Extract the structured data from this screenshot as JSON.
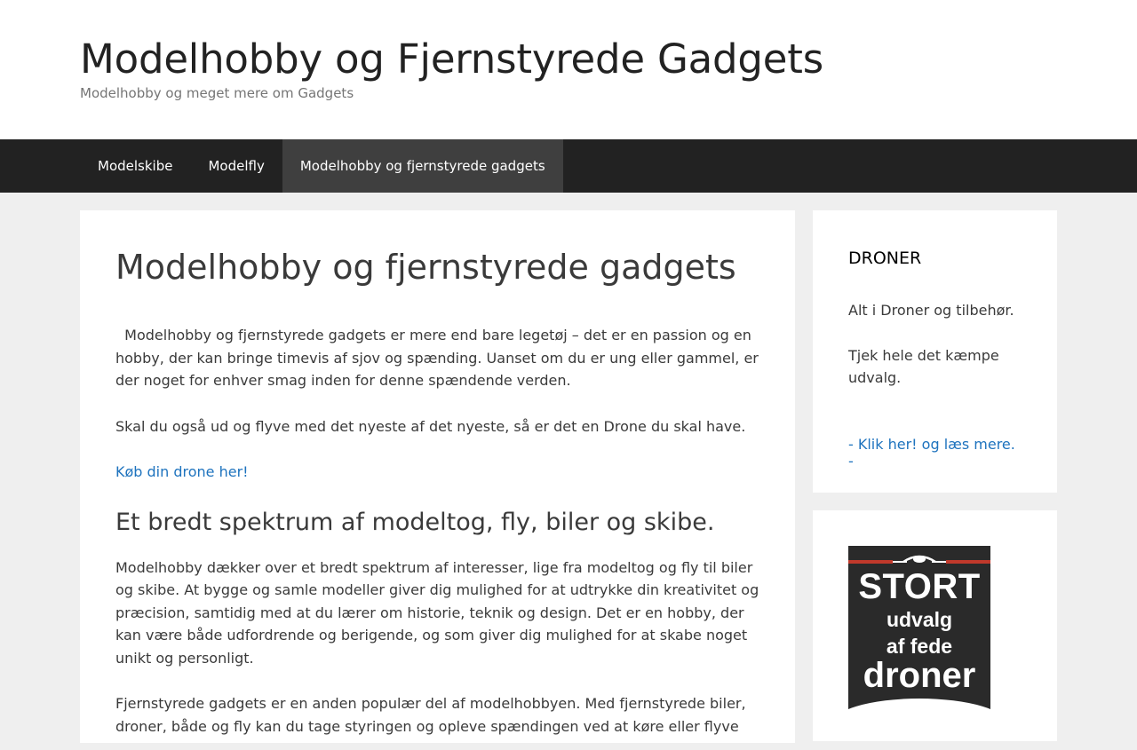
{
  "header": {
    "site_title": "Modelhobby og Fjernstyrede Gadgets",
    "tagline": "Modelhobby og meget mere om Gadgets"
  },
  "nav": {
    "items": [
      {
        "label": "Modelskibe"
      },
      {
        "label": "Modelfly"
      },
      {
        "label": "Modelhobby og fjernstyrede gadgets",
        "current": true
      }
    ]
  },
  "article": {
    "title": "Modelhobby og fjernstyrede gadgets",
    "p1": "  Modelhobby og fjernstyrede gadgets er mere end bare legetøj – det er en passion og en hobby, der kan bringe timevis af sjov og spænding. Uanset om du er ung eller gammel, er der noget for enhver smag inden for denne spændende verden.",
    "p2": "Skal du også ud og flyve med det nyeste af det nyeste, så er det en Drone du skal have.",
    "link": "Køb din drone her!",
    "h2": "Et bredt spektrum af modeltog, fly, biler og skibe.",
    "p3": "Modelhobby dækker over et bredt spektrum af interesser, lige fra modeltog og fly til biler og skibe. At bygge og samle modeller giver dig mulighed for at udtrykke din kreativitet og præcision, samtidig med at du lærer om historie, teknik og design. Det er en hobby, der kan være både udfordrende og berigende, og som giver dig mulighed for at skabe noget unikt og personligt.",
    "p4": "Fjernstyrede gadgets er en anden populær del af modelhobbyen. Med fjernstyrede biler, droner, både og fly kan du tage styringen og opleve spændingen ved at køre eller flyve dit eget køretøj."
  },
  "sidebar": {
    "widget1": {
      "title": "DRONER",
      "p1": "Alt i Droner og tilbehør.",
      "p2": "Tjek hele det kæmpe udvalg.",
      "link": "- Klik her! og læs mere. -"
    },
    "banner": {
      "line1": "STORT",
      "line2": "udvalg",
      "line3": "af fede",
      "line4": "droner"
    }
  },
  "colors": {
    "accent_link": "#1e73be",
    "nav_bg": "#222222",
    "nav_current_bg": "#3f3f3f",
    "page_bg": "#efefef"
  }
}
